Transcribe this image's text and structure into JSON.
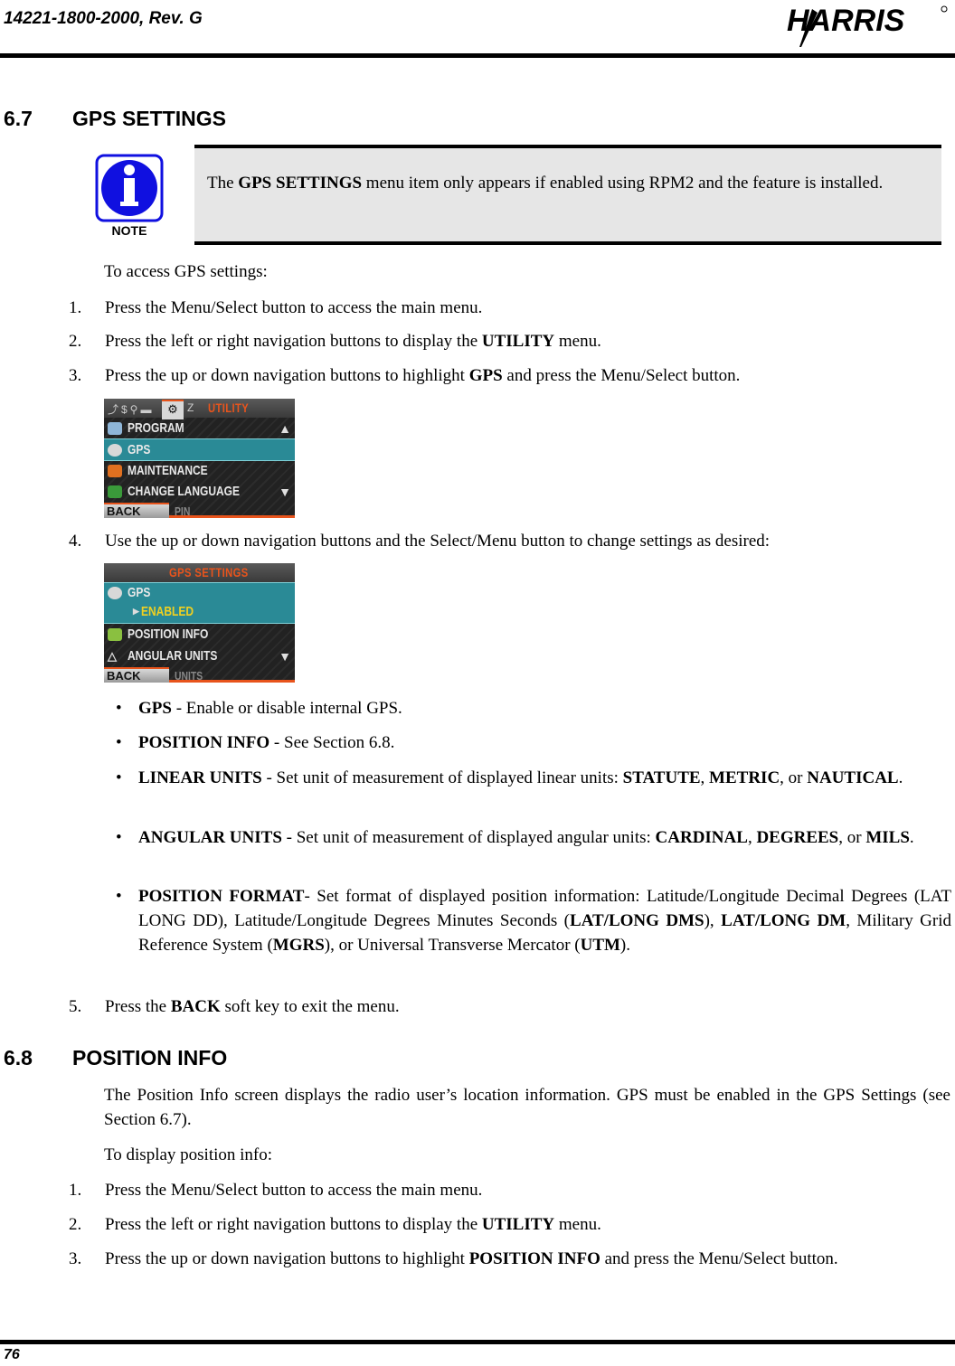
{
  "header": {
    "doc_number": "14221-1800-2000, Rev. G",
    "logo_text": "HARRIS"
  },
  "section_67": {
    "number": "6.7",
    "title": "GPS SETTINGS",
    "note_label": "NOTE",
    "note_pre": "The ",
    "note_bold": "GPS SETTINGS",
    "note_post": " menu item only appears if enabled using RPM2 and the feature is installed.",
    "intro": "To access GPS settings:",
    "steps": [
      {
        "n": "1.",
        "pre": "Press the Menu/Select button to access the main menu.",
        "bold": "",
        "post": ""
      },
      {
        "n": "2.",
        "pre": "Press the left or right navigation buttons to display the ",
        "bold": "UTILITY",
        "post": " menu."
      },
      {
        "n": "3.",
        "pre": "Press the up or down navigation buttons to highlight ",
        "bold": "GPS",
        "post": " and press the Menu/Select button."
      },
      {
        "n": "4.",
        "pre": "Use the up or down navigation buttons and the Select/Menu button to change settings as desired:",
        "bold": "",
        "post": ""
      },
      {
        "n": "5.",
        "pre": "Press the ",
        "bold": "BACK",
        "post": " soft key to exit the menu."
      }
    ],
    "screen1": {
      "title": "UTILITY",
      "rows": [
        "PROGRAM",
        "GPS",
        "MAINTENANCE",
        "CHANGE LANGUAGE"
      ],
      "selected": "GPS",
      "softkey_left": "BACK",
      "softkey_right": "PIN"
    },
    "screen2": {
      "title": "GPS SETTINGS",
      "rows": [
        "GPS",
        "ENABLED",
        "POSITION INFO",
        "ANGULAR UNITS"
      ],
      "selected": "GPS",
      "softkey_left": "BACK",
      "softkey_right": "UNITS"
    },
    "bullets": [
      {
        "bold": "GPS",
        "text": " - Enable or disable internal GPS."
      },
      {
        "bold": "POSITION INFO",
        "text": " - See Section 6.8."
      },
      {
        "bold": "LINEAR UNITS",
        "text": " - Set unit of measurement of displayed linear units: ",
        "b2": "STATUTE",
        "t2": ", ",
        "b3": "METRIC",
        "t3": ", or ",
        "b4": "NAUTICAL",
        "t4": "."
      },
      {
        "bold": "ANGULAR UNITS",
        "text": " - Set unit of measurement of displayed angular units: ",
        "b2": "CARDINAL",
        "t2": ", ",
        "b3": "DEGREES",
        "t3": ", or ",
        "b4": "MILS",
        "t4": "."
      },
      {
        "bold": "POSITION FORMAT",
        "text": "- Set format of displayed position information: Latitude/Longitude Decimal Degrees (LAT LONG DD), Latitude/Longitude Degrees Minutes Seconds (",
        "b2": "LAT/LONG DMS",
        "t2": "), ",
        "b3": "LAT/LONG DM",
        "t3": ", Military Grid Reference System (",
        "b4": "MGRS",
        "t4": "), or Universal Transverse Mercator (",
        "b5": "UTM",
        "t5": ")."
      }
    ]
  },
  "section_68": {
    "number": "6.8",
    "title": "POSITION INFO",
    "para": "The Position Info screen displays the radio user’s location information. GPS must be enabled in the GPS Settings (see Section 6.7).",
    "intro": "To display position info:",
    "steps": [
      {
        "n": "1.",
        "pre": "Press the Menu/Select button to access the main menu.",
        "bold": "",
        "post": ""
      },
      {
        "n": "2.",
        "pre": "Press the left or right navigation buttons to display the ",
        "bold": "UTILITY",
        "post": " menu."
      },
      {
        "n": "3.",
        "pre": "Press the up or down navigation buttons to highlight ",
        "bold": "POSITION INFO",
        "post": " and press the Menu/Select button."
      }
    ]
  },
  "footer": {
    "page_number": "76"
  }
}
